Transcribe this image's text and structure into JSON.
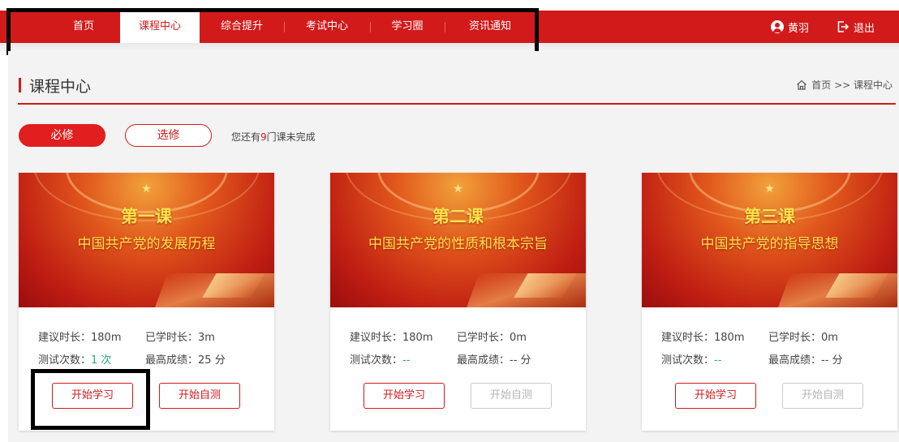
{
  "nav": {
    "items": [
      "首页",
      "课程中心",
      "综合提升",
      "考试中心",
      "学习圈",
      "资讯通知"
    ],
    "active": "课程中心"
  },
  "user": {
    "name": "黄羽",
    "logout_label": "退出"
  },
  "page": {
    "title": "课程中心",
    "breadcrumb": "首页 >> 课程中心"
  },
  "filters": {
    "required_label": "必修",
    "elective_label": "选修",
    "remaining_prefix": "您还有",
    "remaining_count": "9",
    "remaining_suffix": "门课未完成"
  },
  "courses": [
    {
      "lesson": "第一课",
      "name": "中国共产党的发展历程",
      "suggested_label": "建议时长：",
      "suggested_value": "180m",
      "studied_label": "已学时长：",
      "studied_value": "3m",
      "tests_label": "测试次数：",
      "tests_value": "1 次",
      "best_label": "最高成绩：",
      "best_value": "25 分",
      "start_label": "开始学习",
      "selftest_label": "开始自测",
      "selftest_enabled": true
    },
    {
      "lesson": "第二课",
      "name": "中国共产党的性质和根本宗旨",
      "suggested_label": "建议时长：",
      "suggested_value": "180m",
      "studied_label": "已学时长：",
      "studied_value": "0m",
      "tests_label": "测试次数：",
      "tests_value": "--",
      "best_label": "最高成绩：",
      "best_value": "-- 分",
      "start_label": "开始学习",
      "selftest_label": "开始自测",
      "selftest_enabled": false
    },
    {
      "lesson": "第三课",
      "name": "中国共产党的指导思想",
      "suggested_label": "建议时长：",
      "suggested_value": "180m",
      "studied_label": "已学时长：",
      "studied_value": "0m",
      "tests_label": "测试次数：",
      "tests_value": "--",
      "best_label": "最高成绩：",
      "best_value": "-- 分",
      "start_label": "开始学习",
      "selftest_label": "开始自测",
      "selftest_enabled": false
    }
  ],
  "colors": {
    "brand_red": "#d21a1a",
    "accent_green": "#2aa87e",
    "banner_gold": "#ffe34a"
  }
}
